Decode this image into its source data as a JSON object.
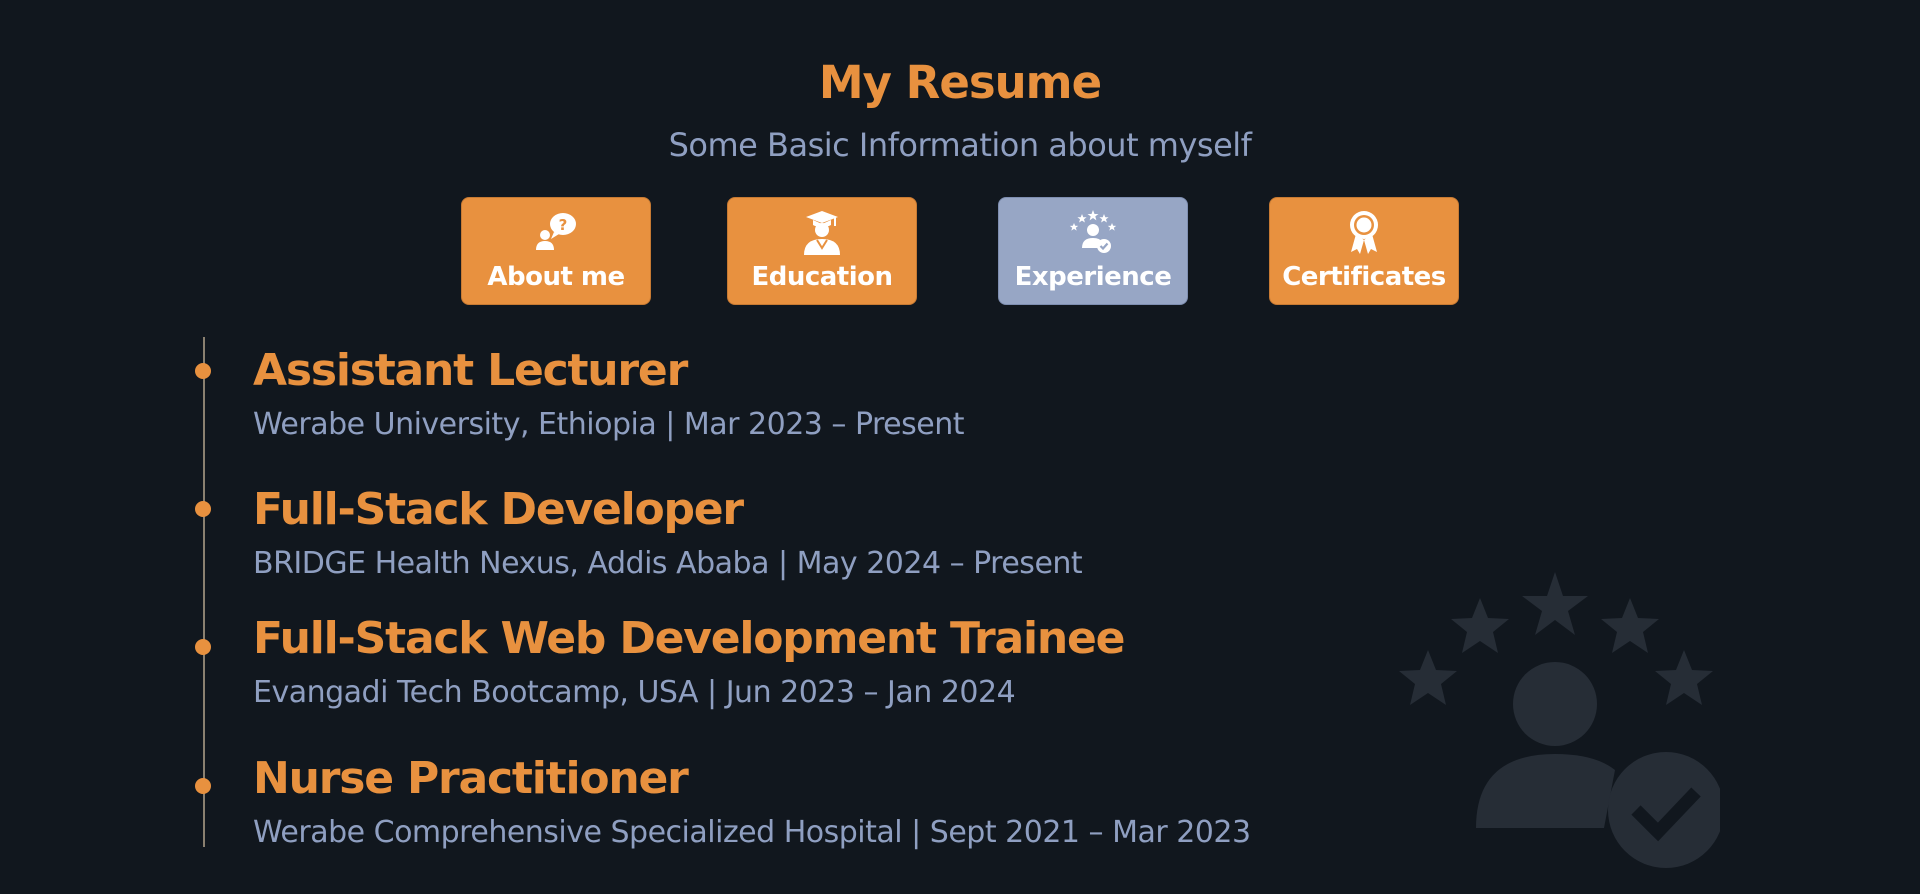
{
  "header": {
    "title": "My Resume",
    "subtitle": "Some Basic Information about myself"
  },
  "tabs": [
    {
      "label": "About me",
      "icon": "user-question-icon",
      "active": false
    },
    {
      "label": "Education",
      "icon": "graduate-icon",
      "active": false
    },
    {
      "label": "Experience",
      "icon": "user-stars-check-icon",
      "active": true
    },
    {
      "label": "Certificates",
      "icon": "award-ribbon-icon",
      "active": false
    }
  ],
  "experience": [
    {
      "role": "Assistant Lecturer",
      "org": "Werabe University, Ethiopia | Mar 2023 – Present"
    },
    {
      "role": "Full-Stack Developer",
      "org": "BRIDGE Health Nexus, Addis Ababa | May 2024 – Present"
    },
    {
      "role": "Full-Stack Web Development Trainee",
      "org": "Evangadi Tech Bootcamp, USA | Jun 2023 – Jan 2024"
    },
    {
      "role": "Nurse Practitioner",
      "org": "Werabe Comprehensive Specialized Hospital | Sept 2021 – Mar 2023"
    }
  ],
  "colors": {
    "background": "#11171e",
    "accent": "#e8913f",
    "muted": "#8f9fc1",
    "active_tab": "#97a6c5",
    "watermark": "#262d36"
  },
  "watermark_icon": "user-stars-check-icon"
}
